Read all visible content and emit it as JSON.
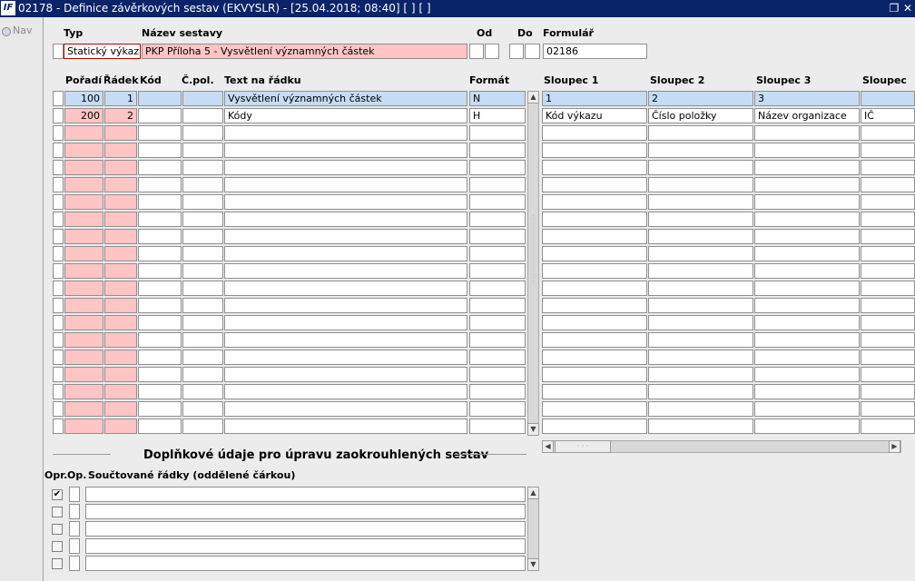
{
  "window": {
    "title": "02178 - Definice závěrkových sestav (EKVYSLR) - [25.04.2018; 08:40]  [ ]  [ ]",
    "app_icon": "IF",
    "restore_icon": "window-restore-icon",
    "close_icon": "close-icon"
  },
  "nav": {
    "label": "Nav"
  },
  "header": {
    "typ_label": "Typ",
    "nazev_label": "Název sestavy",
    "od_label": "Od",
    "do_label": "Do",
    "formular_label": "Formulář",
    "typ_value": "Statický výkaz",
    "nazev_value": "PKP Příloha 5 - Vysvětlení významných částek",
    "od_value": "",
    "do_value": "",
    "formular_value": "02186"
  },
  "grid_left": {
    "headers": {
      "poradi": "Pořadí",
      "radek": "Řádek",
      "kod": "Kód",
      "cpol": "Č.pol.",
      "text": "Text na řádku",
      "format": "Formát"
    },
    "rows": [
      {
        "poradi": "100",
        "radek": "1",
        "kod": "",
        "cpol": "",
        "text": "Vysvětlení významných částek",
        "format": "N"
      },
      {
        "poradi": "200",
        "radek": "2",
        "kod": "",
        "cpol": "",
        "text": "Kódy",
        "format": "H"
      },
      {
        "poradi": "",
        "radek": "",
        "kod": "",
        "cpol": "",
        "text": "",
        "format": ""
      },
      {
        "poradi": "",
        "radek": "",
        "kod": "",
        "cpol": "",
        "text": "",
        "format": ""
      },
      {
        "poradi": "",
        "radek": "",
        "kod": "",
        "cpol": "",
        "text": "",
        "format": ""
      },
      {
        "poradi": "",
        "radek": "",
        "kod": "",
        "cpol": "",
        "text": "",
        "format": ""
      },
      {
        "poradi": "",
        "radek": "",
        "kod": "",
        "cpol": "",
        "text": "",
        "format": ""
      },
      {
        "poradi": "",
        "radek": "",
        "kod": "",
        "cpol": "",
        "text": "",
        "format": ""
      },
      {
        "poradi": "",
        "radek": "",
        "kod": "",
        "cpol": "",
        "text": "",
        "format": ""
      },
      {
        "poradi": "",
        "radek": "",
        "kod": "",
        "cpol": "",
        "text": "",
        "format": ""
      },
      {
        "poradi": "",
        "radek": "",
        "kod": "",
        "cpol": "",
        "text": "",
        "format": ""
      },
      {
        "poradi": "",
        "radek": "",
        "kod": "",
        "cpol": "",
        "text": "",
        "format": ""
      },
      {
        "poradi": "",
        "radek": "",
        "kod": "",
        "cpol": "",
        "text": "",
        "format": ""
      },
      {
        "poradi": "",
        "radek": "",
        "kod": "",
        "cpol": "",
        "text": "",
        "format": ""
      },
      {
        "poradi": "",
        "radek": "",
        "kod": "",
        "cpol": "",
        "text": "",
        "format": ""
      },
      {
        "poradi": "",
        "radek": "",
        "kod": "",
        "cpol": "",
        "text": "",
        "format": ""
      },
      {
        "poradi": "",
        "radek": "",
        "kod": "",
        "cpol": "",
        "text": "",
        "format": ""
      },
      {
        "poradi": "",
        "radek": "",
        "kod": "",
        "cpol": "",
        "text": "",
        "format": ""
      },
      {
        "poradi": "",
        "radek": "",
        "kod": "",
        "cpol": "",
        "text": "",
        "format": ""
      },
      {
        "poradi": "",
        "radek": "",
        "kod": "",
        "cpol": "",
        "text": "",
        "format": ""
      }
    ]
  },
  "grid_right": {
    "headers": [
      "Sloupec 1",
      "Sloupec 2",
      "Sloupec 3",
      "Sloupec"
    ],
    "rows": [
      [
        "1",
        "2",
        "3",
        ""
      ],
      [
        "Kód výkazu",
        "Číslo položky",
        "Název organizace",
        "IČ"
      ],
      [
        "",
        "",
        "",
        ""
      ],
      [
        "",
        "",
        "",
        ""
      ],
      [
        "",
        "",
        "",
        ""
      ],
      [
        "",
        "",
        "",
        ""
      ],
      [
        "",
        "",
        "",
        ""
      ],
      [
        "",
        "",
        "",
        ""
      ],
      [
        "",
        "",
        "",
        ""
      ],
      [
        "",
        "",
        "",
        ""
      ],
      [
        "",
        "",
        "",
        ""
      ],
      [
        "",
        "",
        "",
        ""
      ],
      [
        "",
        "",
        "",
        ""
      ],
      [
        "",
        "",
        "",
        ""
      ],
      [
        "",
        "",
        "",
        ""
      ],
      [
        "",
        "",
        "",
        ""
      ],
      [
        "",
        "",
        "",
        ""
      ],
      [
        "",
        "",
        "",
        ""
      ],
      [
        "",
        "",
        "",
        ""
      ],
      [
        "",
        "",
        "",
        ""
      ]
    ]
  },
  "bottom": {
    "section_title": "Doplňkové údaje pro úpravu zaokrouhlených sestav",
    "opr_label": "Opr.",
    "op_label": "Op.",
    "soucet_label": "Součtované řádky (oddělené čárkou)",
    "check_mark": "✔",
    "rows": [
      {
        "opr": true,
        "op": false,
        "value": ""
      },
      {
        "opr": false,
        "op": false,
        "value": ""
      },
      {
        "opr": false,
        "op": false,
        "value": ""
      },
      {
        "opr": false,
        "op": false,
        "value": ""
      },
      {
        "opr": false,
        "op": false,
        "value": ""
      }
    ]
  }
}
